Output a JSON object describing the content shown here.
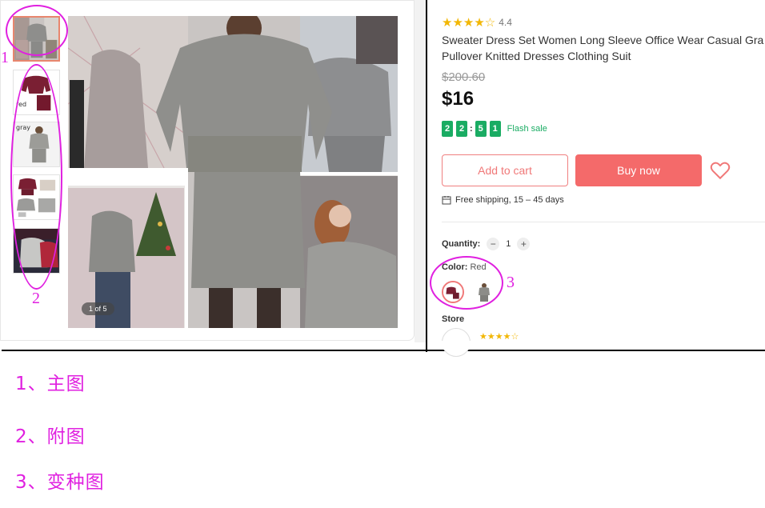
{
  "gallery": {
    "counter": "1 of 5",
    "thumbnail_labels": [
      "red",
      "gray"
    ]
  },
  "product": {
    "rating": "4.4",
    "title_line1": "Sweater Dress Set Women Long Sleeve Office Wear Casual Gra",
    "title_line2": "Pullover Knitted Dresses Clothing Suit",
    "old_price": "$200.60",
    "price": "$16",
    "timer": [
      "2",
      "2",
      "5",
      "1"
    ],
    "flash_sale": "Flash sale",
    "add_to_cart": "Add to cart",
    "buy_now": "Buy now",
    "shipping": "Free shipping, 15 – 45 days",
    "quantity_label": "Quantity:",
    "quantity_minus": "−",
    "quantity_value": "1",
    "quantity_plus": "+",
    "color_label": "Color:",
    "color_value": "Red",
    "store_label": "Store"
  },
  "annotations": {
    "marker1": "1",
    "marker2": "2",
    "marker3": "3",
    "legend": [
      "1、主图",
      "2、附图",
      "3、变种图"
    ]
  },
  "colors": {
    "accent": "#f46a6a",
    "flash_green": "#1aac63",
    "annotation": "#e020e0",
    "star": "#f2b705"
  }
}
